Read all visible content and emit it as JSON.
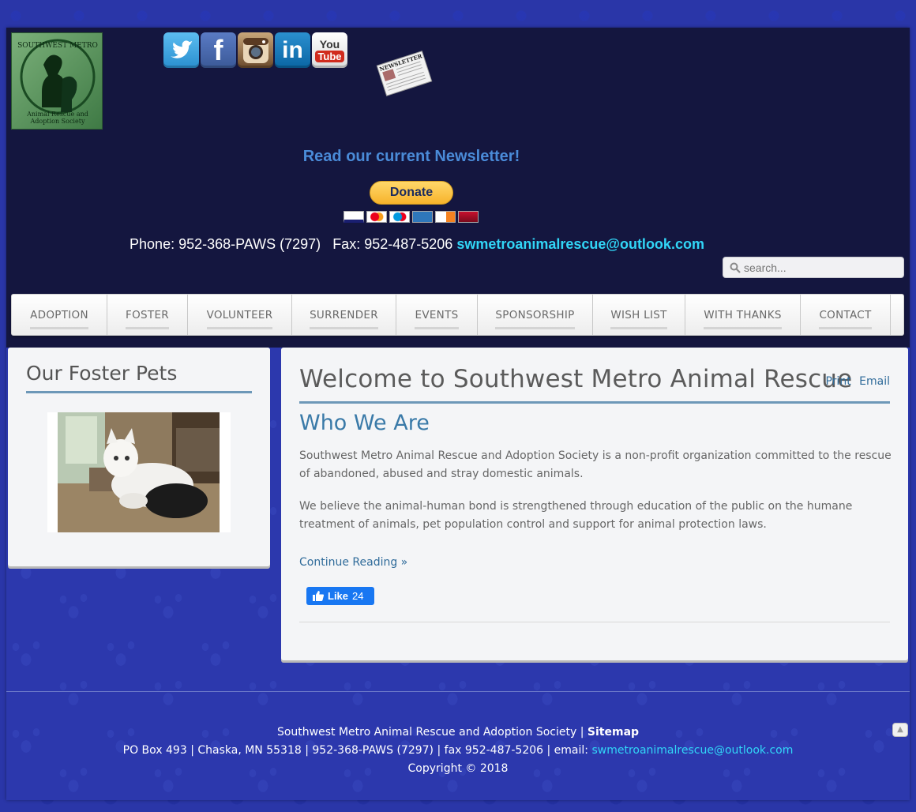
{
  "header": {
    "logo_alt_lines": [
      "Animal Rescue and",
      "Adoption Society"
    ],
    "social": [
      {
        "name": "twitter",
        "glyph": "🐦"
      },
      {
        "name": "facebook",
        "glyph": "f"
      },
      {
        "name": "instagram",
        "glyph": ""
      },
      {
        "name": "linkedin",
        "glyph": "in"
      },
      {
        "name": "youtube",
        "glyph_top": "You",
        "glyph_bottom": "Tube"
      }
    ],
    "newsletter_img_label": "NEWSLETTER",
    "newsletter_link": "Read our current Newsletter!",
    "donate_label": "Donate",
    "cards": [
      "VISA",
      "MC",
      "Maestro",
      "AmEx",
      "Discover",
      "Bank"
    ],
    "phone": "Phone: 952-368-PAWS (7297)",
    "fax": "Fax: 952-487-5206",
    "email": "swmetroanimalrescue@outlook.com",
    "search_placeholder": "search..."
  },
  "nav": [
    {
      "label": "ADOPTION"
    },
    {
      "label": "FOSTER"
    },
    {
      "label": "VOLUNTEER"
    },
    {
      "label": "SURRENDER"
    },
    {
      "label": "EVENTS"
    },
    {
      "label": "SPONSORSHIP"
    },
    {
      "label": "WISH LIST"
    },
    {
      "label": "WITH THANKS"
    },
    {
      "label": "CONTACT"
    }
  ],
  "sidebar": {
    "title": "Our Foster Pets"
  },
  "main": {
    "title": "Welcome to Southwest Metro Animal Rescue",
    "print_label": "Print",
    "email_label": "Email",
    "subtitle": "Who We Are",
    "paragraphs": [
      "Southwest Metro Animal Rescue and Adoption Society is a non-profit organization committed to the rescue of abandoned, abused and stray domestic animals.",
      "We believe the animal-human bond is strengthened through education of the public on the humane treatment of animals, pet population control and support for animal protection laws."
    ],
    "continue_label": "Continue Reading »",
    "like_label": "Like",
    "like_count": "24"
  },
  "footer": {
    "org": "Southwest Metro Animal Rescue and Adoption Society",
    "sep1": " | ",
    "sitemap": "Sitemap",
    "address": "PO Box 493 | Chaska, MN 55318 | 952-368-PAWS (7297) | fax 952-487-5206 | email: ",
    "email": "swmetroanimalrescue@outlook.com",
    "copyright": "Copyright © 2018"
  },
  "colors": {
    "background": "#2c38ad",
    "header": "#14163f",
    "accent_link": "#2f6b9a",
    "email_cyan": "#31d6f7",
    "heading_rule": "#6d98b8"
  }
}
